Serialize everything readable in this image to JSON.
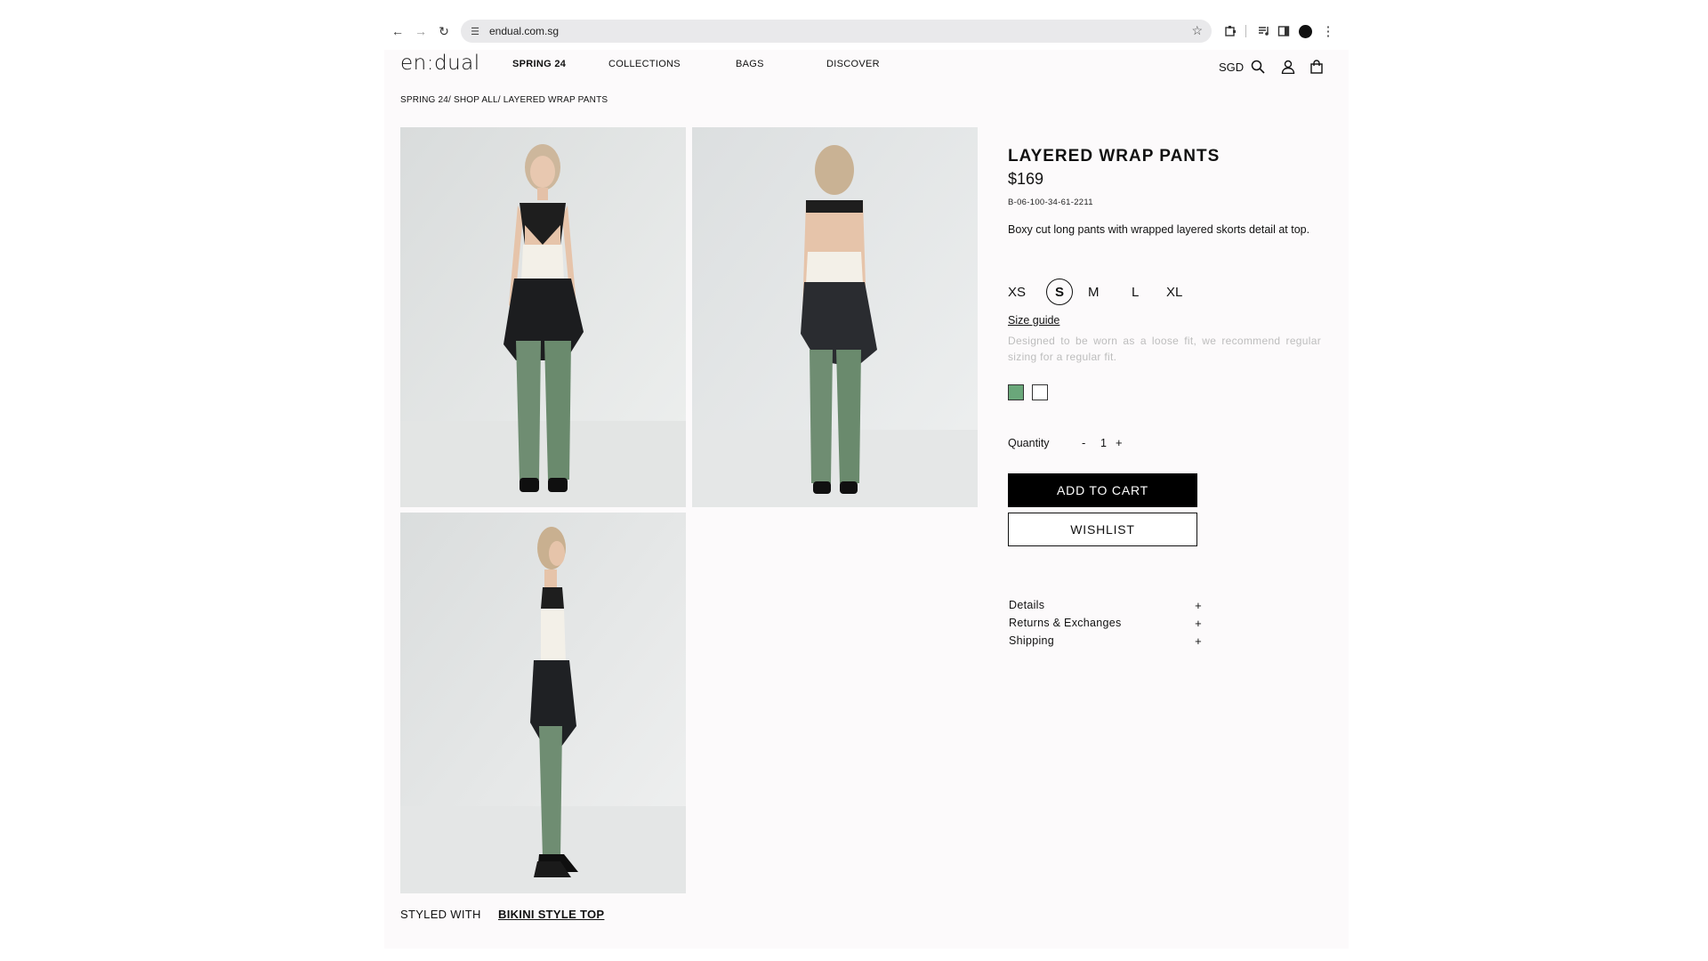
{
  "browser": {
    "url": "endual.com.sg",
    "icons": [
      "back-arrow-icon",
      "forward-arrow-icon",
      "reload-icon",
      "site-settings-icon",
      "bookmark-star-icon",
      "extensions-icon",
      "media-icon",
      "side-panel-icon",
      "profile-icon",
      "menu-kebab-icon"
    ]
  },
  "site": {
    "logo": "en:dual",
    "nav": {
      "spring": "SPRING 24",
      "collections": "COLLECTIONS",
      "bags": "BAGS",
      "discover": "DISCOVER"
    },
    "currency": "SGD",
    "icons": [
      "search-icon",
      "account-icon",
      "shopping-bag-icon"
    ]
  },
  "breadcrumb": "SPRING 24/ SHOP ALL/ LAYERED WRAP PANTS",
  "gallery": {
    "images": [
      "front-view",
      "back-view",
      "side-view"
    ]
  },
  "styled_with": {
    "label": "STYLED WITH",
    "link": "BIKINI STYLE TOP"
  },
  "product": {
    "title": "LAYERED WRAP PANTS",
    "price": "$169",
    "sku": "B-06-100-34-61-2211",
    "description": "Boxy cut long pants with wrapped layered skorts detail at top.",
    "sizes": [
      "XS",
      "S",
      "M",
      "L",
      "XL"
    ],
    "selected_size": "S",
    "size_guide": "Size guide",
    "fit_note": "Designed to be worn as a loose fit, we recommend regular sizing for a regular fit.",
    "colors": [
      "#6aa77a",
      "#ffffff"
    ],
    "quantity_label": "Quantity",
    "qty_minus": "-",
    "qty_value": "1",
    "qty_plus": "+",
    "add_to_cart": "ADD TO CART",
    "wishlist": "WISHLIST",
    "accordion": [
      {
        "label": "Details",
        "icon": "+"
      },
      {
        "label": "Returns & Exchanges",
        "icon": "+"
      },
      {
        "label": "Shipping",
        "icon": "+"
      }
    ]
  }
}
